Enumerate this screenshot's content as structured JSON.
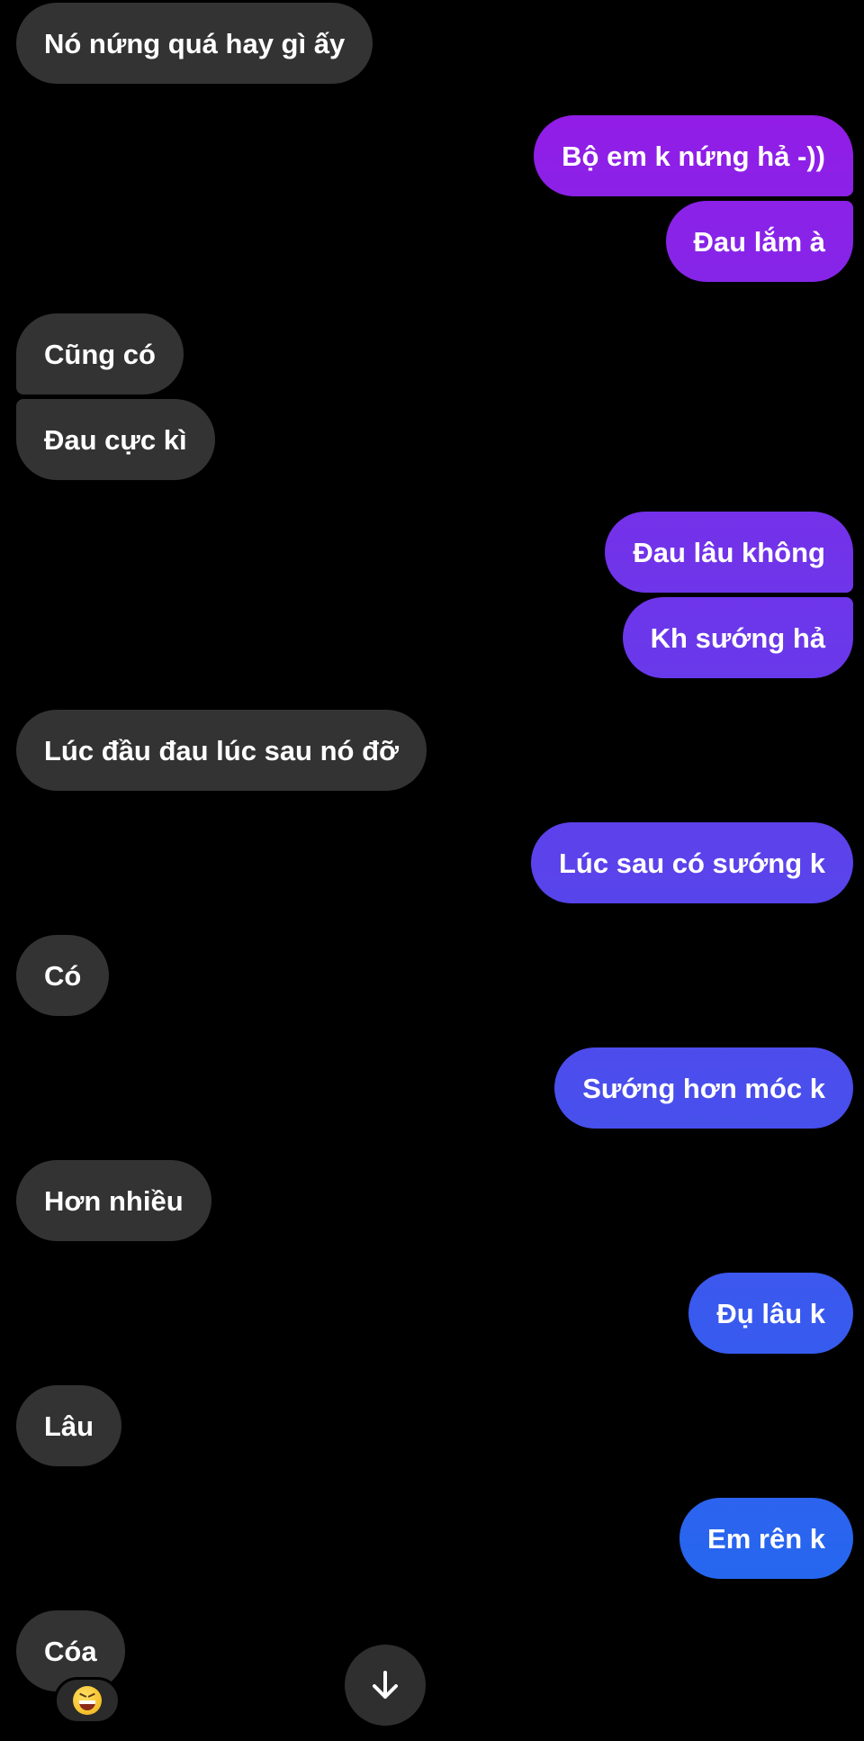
{
  "messages": [
    {
      "side": "in",
      "text": "Nó nứng quá hay gì ấy"
    },
    {
      "side": "out",
      "text": "Bộ em k nứng hả -))"
    },
    {
      "side": "out",
      "text": "Đau lắm à"
    },
    {
      "side": "in",
      "text": "Cũng có"
    },
    {
      "side": "in",
      "text": "Đau cực kì"
    },
    {
      "side": "out",
      "text": "Đau lâu không"
    },
    {
      "side": "out",
      "text": "Kh sướng hả"
    },
    {
      "side": "in",
      "text": "Lúc đầu đau lúc sau nó đỡ"
    },
    {
      "side": "out",
      "text": "Lúc sau có sướng k"
    },
    {
      "side": "in",
      "text": "Có"
    },
    {
      "side": "out",
      "text": "Sướng hơn móc k"
    },
    {
      "side": "in",
      "text": "Hơn nhiều"
    },
    {
      "side": "out",
      "text": "Đụ lâu k"
    },
    {
      "side": "in",
      "text": "Lâu"
    },
    {
      "side": "out",
      "text": "Em rên k"
    },
    {
      "side": "in",
      "text": "Cóa"
    }
  ],
  "reaction": {
    "icon": "grinning-squinting-face-emoji",
    "on_message": "Cóa"
  },
  "scroll_button": {
    "icon": "arrow-down-icon"
  },
  "colors": {
    "background": "#000000",
    "incoming_bubble": "#333333",
    "outgoing_gradient_top": "#9a17e6",
    "outgoing_gradient_bottom": "#1a6ff0",
    "text": "#ffffff"
  }
}
